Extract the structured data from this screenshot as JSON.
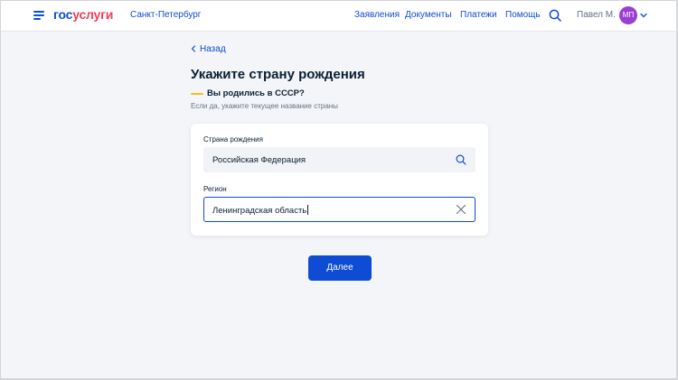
{
  "header": {
    "logo_part1": "гос",
    "logo_part2": "услуги",
    "city": "Санкт-Петербург",
    "nav": [
      "Заявления",
      "Документы",
      "Платежи",
      "Помощь"
    ],
    "user_name": "Павел М.",
    "avatar_initials": "МП"
  },
  "back_label": "Назад",
  "page_title": "Укажите страну рождения",
  "question": "Вы родились в СССР?",
  "hint": "Если да, укажите текущее название страны",
  "form": {
    "country_label": "Страна рождения",
    "country_value": "Российская Федерация",
    "region_label": "Регион",
    "region_value": "Ленинградская область"
  },
  "next_button": "Далее",
  "colors": {
    "brand_blue": "#0d4cd3",
    "brand_red": "#ee3f58",
    "avatar": "#9b3fd3",
    "accent_yellow": "#f1c21b",
    "background": "#f4f5f8"
  },
  "icons": [
    "menu-icon",
    "search-icon",
    "chevron-down-icon",
    "chevron-left-icon",
    "clear-icon"
  ]
}
